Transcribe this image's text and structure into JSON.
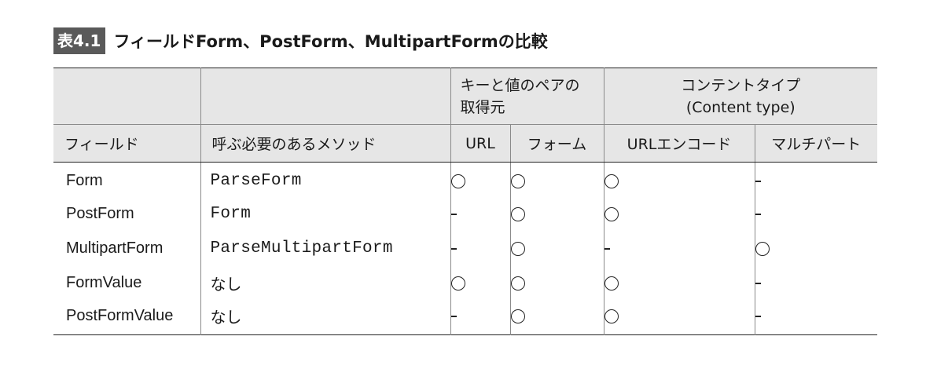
{
  "caption": {
    "badge": "表4.1",
    "title": "フィールドForm、PostForm、MultipartFormの比較"
  },
  "header": {
    "group_source_line1": "キーと値のペアの",
    "group_source_line2": "取得元",
    "group_content_type_line1": "コンテントタイプ",
    "group_content_type_line2": "(Content type)",
    "col_field": "フィールド",
    "col_method": "呼ぶ必要のあるメソッド",
    "col_url": "URL",
    "col_form": "フォーム",
    "col_urlencoded": "URLエンコード",
    "col_multipart": "マルチパート"
  },
  "rows": [
    {
      "field": "Form",
      "method": "ParseForm",
      "method_mono": true,
      "url": "○",
      "form": "○",
      "urlencoded": "○",
      "multipart": "-"
    },
    {
      "field": "PostForm",
      "method": "Form",
      "method_mono": true,
      "url": "-",
      "form": "○",
      "urlencoded": "○",
      "multipart": "-"
    },
    {
      "field": "MultipartForm",
      "method": "ParseMultipartForm",
      "method_mono": true,
      "url": "-",
      "form": "○",
      "urlencoded": "-",
      "multipart": "○"
    },
    {
      "field": "FormValue",
      "method": "なし",
      "method_mono": false,
      "url": "○",
      "form": "○",
      "urlencoded": "○",
      "multipart": "-"
    },
    {
      "field": "PostFormValue",
      "method": "なし",
      "method_mono": false,
      "url": "-",
      "form": "○",
      "urlencoded": "○",
      "multipart": "-"
    }
  ]
}
